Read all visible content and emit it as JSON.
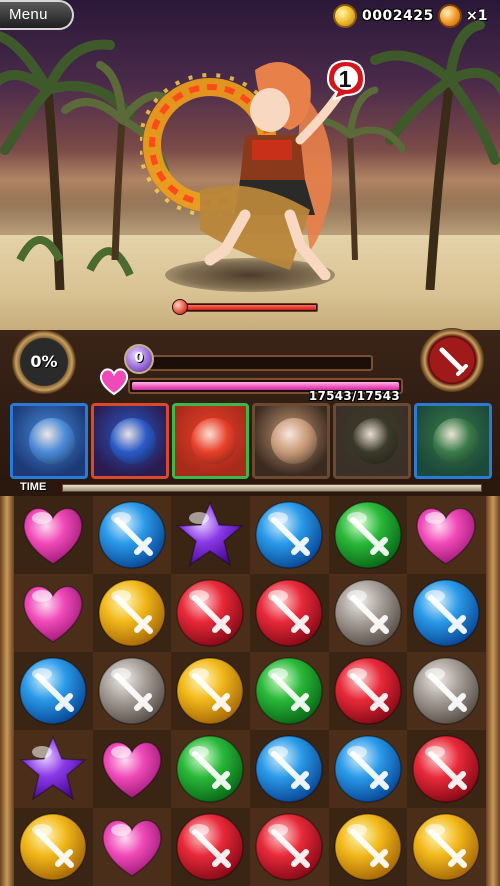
{
  "header": {
    "menu_label": "Menu",
    "coin_count": "0002425",
    "stone_count": "×1",
    "coin_icon": "gold-coin-icon",
    "stone_icon": "magic-stone-icon"
  },
  "enemy": {
    "turns_until_attack": "1",
    "hp_fraction": 1.0,
    "element_icon": "fire-element-icon"
  },
  "party": {
    "skill_gauge_label": "0%",
    "shield_value": "0",
    "shield_fraction": 0.0,
    "hp_text": "17543/17543",
    "hp_fraction": 1.0,
    "members": [
      {
        "element": "water",
        "frame_color": "#2a7ad8",
        "bg_color": "#1c3a78",
        "face_color": "#4a8ad8"
      },
      {
        "element": "fire",
        "frame_color": "#d84a2a",
        "bg_color": "#2a1c50",
        "face_color": "#2a5ac8"
      },
      {
        "element": "wood",
        "frame_color": "#3ab84a",
        "bg_color": "#a82a1a",
        "face_color": "#e8402a"
      },
      {
        "element": "wood",
        "frame_color": "#6a4a30",
        "bg_color": "#3a2a20",
        "face_color": "#c89a78"
      },
      {
        "element": "dark",
        "frame_color": "#6a4a30",
        "bg_color": "#3a3028",
        "face_color": "#3a3a2a"
      },
      {
        "element": "water",
        "frame_color": "#2a7ad8",
        "bg_color": "#1c4a3a",
        "face_color": "#3a7a4a"
      }
    ]
  },
  "time": {
    "label": "TIME",
    "fraction": 1.0
  },
  "board": {
    "rows": [
      [
        "heart",
        "blue",
        "purple",
        "blue",
        "green",
        "heart"
      ],
      [
        "heart",
        "yellow",
        "red",
        "red",
        "gray",
        "blue"
      ],
      [
        "blue",
        "gray",
        "yellow",
        "green",
        "red",
        "gray"
      ],
      [
        "purple",
        "heart",
        "green",
        "blue",
        "blue",
        "red"
      ],
      [
        "yellow",
        "heart",
        "red",
        "red",
        "yellow",
        "yellow"
      ]
    ],
    "orb_colors": {
      "blue": [
        "#d8f0ff",
        "#2a9ae8",
        "#0a4a98"
      ],
      "green": [
        "#d8ffd0",
        "#2ab83a",
        "#0a6a18"
      ],
      "yellow": [
        "#fff8c0",
        "#f2b81a",
        "#a86a08"
      ],
      "red": [
        "#ffd0d0",
        "#e82a3a",
        "#8a0a18"
      ],
      "gray": [
        "#f0ece8",
        "#a8a09a",
        "#5a524a"
      ],
      "heart": [
        "#ffd8f0",
        "#f04ab8",
        "#a01a78"
      ],
      "purple": [
        "#e8d0ff",
        "#8a3ae8",
        "#4a0a98"
      ]
    }
  }
}
